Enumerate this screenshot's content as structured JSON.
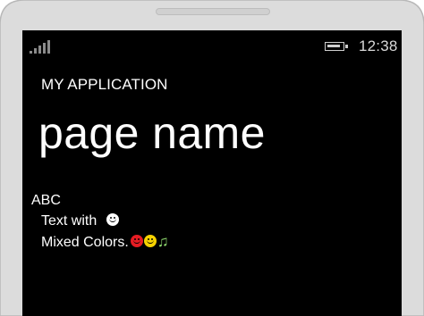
{
  "device": {
    "speaker_label": ""
  },
  "status_bar": {
    "time": "12:38",
    "signal_icon": "signal-strength-icon",
    "battery_icon": "battery-icon"
  },
  "app": {
    "title": "MY APPLICATION",
    "page_name": "page name"
  },
  "content": {
    "heading": "ABC",
    "line1_text": "Text with ",
    "line1_emoji": "white-smiley-icon",
    "line2_text": "Mixed Colors.",
    "line2_emojis": [
      "red-smiley-icon",
      "yellow-smiley-icon"
    ],
    "line2_note": "♫"
  },
  "colors": {
    "screen_background": "#000000",
    "text": "#ffffff",
    "red_emoji": "#e51c23",
    "yellow_emoji": "#f6d200",
    "green_note": "#8bd36b"
  }
}
